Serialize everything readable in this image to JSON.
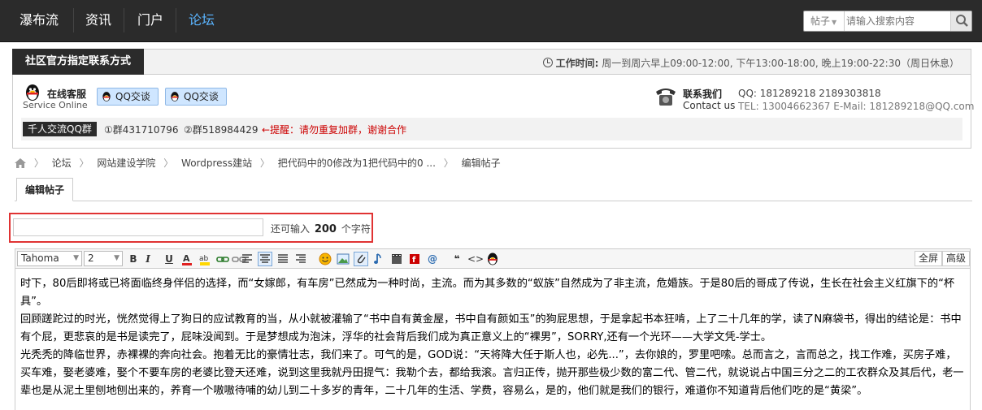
{
  "nav": {
    "items": [
      "瀑布流",
      "资讯",
      "门户",
      "论坛"
    ],
    "active_index": 3,
    "search_scope": "帖子",
    "search_placeholder": "请输入搜索内容"
  },
  "contact": {
    "title": "社区官方指定联系方式",
    "hours_label": "工作时间:",
    "hours_text": "周一到周六早上09:00-12:00, 下午13:00-18:00, 晚上19:00-22:30（周日休息）",
    "service_cn": "在线客服",
    "service_en": "Service Online",
    "qq_btn_1": "QQ交谈",
    "qq_btn_2": "QQ交谈",
    "contact_cn": "联系我们",
    "contact_en": "Contact us",
    "qq_line": "QQ: 181289218  2189303818",
    "tel_line": "TEL: 13004662367 E-Mail: 181289218@QQ.com",
    "group_label": "千人交流QQ群",
    "group_1": "①群431710796",
    "group_2": "②群518984429",
    "group_warning": "←提醒：请勿重复加群，谢谢合作"
  },
  "breadcrumb": [
    "论坛",
    "网站建设学院",
    "Wordpress建站",
    "把代码中的0修改为1把代码中的0 ...",
    "编辑帖子"
  ],
  "tab_label": "编辑帖子",
  "title_field": {
    "value": "",
    "remain_prefix": "还可输入",
    "remain_count": "200",
    "remain_suffix": "个字符"
  },
  "toolbar": {
    "font": "Tahoma",
    "size": "2",
    "bold": "B",
    "italic": "I",
    "underline": "U",
    "fullscreen": "全屏",
    "advanced": "高级"
  },
  "editor": {
    "paragraphs": [
      " 时下，80后即将或已将面临终身伴侣的选择，而“女嫁郎，有车房”已然成为一种时尚，主流。而为其多数的“蚁族”自然成为了非主流，危婚族。于是80后的哥成了传说，生长在社会主义红旗下的“杯具”。",
      "回顾蹉跎过的时光，恍然觉得上了狗日的应试教育的当，从小就被灌输了“书中自有黄金屋，书中自有颜如玉”的狗屁思想，于是拿起书本狂啃，上了二十几年的学，读了N麻袋书，得出的结论是：书中有个屁，更悲哀的是书是读完了，屁味没闻到。于是梦想成为泡沫，浮华的社会背后我们成为真正意义上的“裸男”，SORRY,还有一个光环——大学文凭-学士。",
      "光秃秃的降临世界，赤裸裸的奔向社会。抱着无比的豪情壮志，我们来了。可气的是，GOD说：“天将降大任于斯人也，必先...”，去你娘的，罗里吧嗦。总而言之，言而总之，找工作难，买房子难，买车难，娶老婆难，娶个不要车房的老婆比登天还难，说到这里我就丹田提气：我勒个去，都给我滚。言归正传，抛开那些极少数的富二代、管二代，就说说占中国三分之二的工农群众及其后代，老一辈也是从泥土里刨地刨出来的，养育一个嗷嗷待哺的幼儿到二十多岁的青年，二十几年的生活、学费，容易么，是的，他们就是我们的银行，难道你不知道背后他们吃的是“黄梁”。"
    ]
  },
  "colors": {
    "nav_bg": "#2b2b2b",
    "nav_active": "#5ab4ff",
    "warning": "#cc0000",
    "highlight_border": "#e03333"
  }
}
